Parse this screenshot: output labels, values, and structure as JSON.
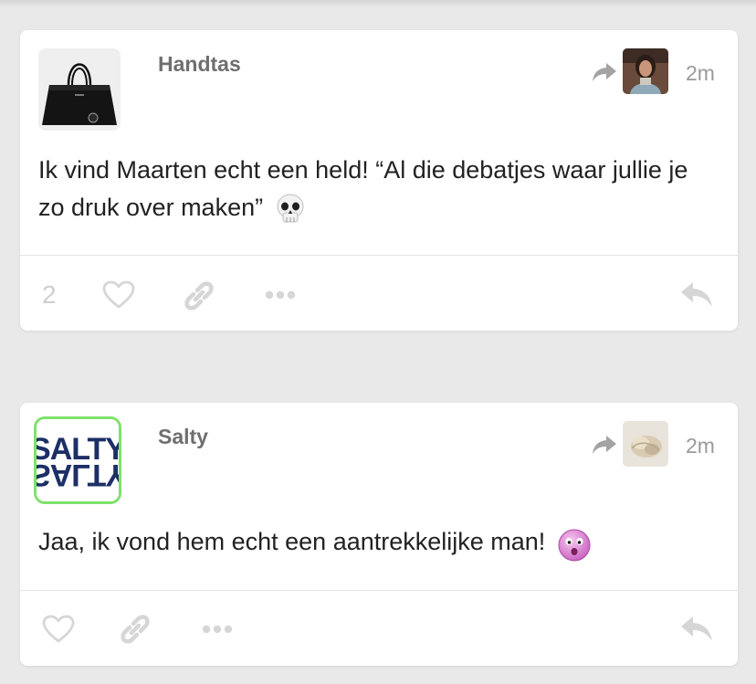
{
  "posts": [
    {
      "username": "Handtas",
      "timestamp": "2m",
      "avatar_icon": "handbag-avatar",
      "text": "Ik vind Maarten echt een held! “Al die debatjes waar jullie je zo druk over maken”",
      "emoji": "skull-emoji",
      "note_count": "2"
    },
    {
      "username": "Salty",
      "timestamp": "2m",
      "avatar_icon": "salty-logo-avatar",
      "avatar_logo_text": "SALTY",
      "text": "Jaa, ik vond hem echt een aantrekkelijke man!",
      "emoji": "surprised-face-emoji"
    }
  ],
  "colors": {
    "background": "#e9e9e9",
    "card": "#ffffff",
    "username": "#6f6f6f",
    "timestamp": "#9a9a9a",
    "action_icons": "#d6d6d6",
    "salty_border": "#7ee26a",
    "salty_logo": "#1c2f66"
  }
}
